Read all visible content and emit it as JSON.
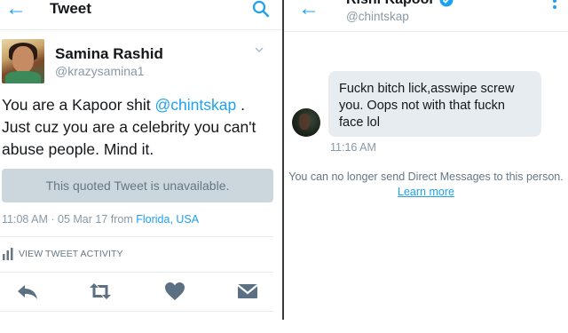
{
  "left": {
    "header": {
      "back_icon": "arrow-left-icon",
      "title": "Tweet",
      "search_icon": "search-icon"
    },
    "author": {
      "name": "Samina Rashid",
      "handle": "@krazysamina1"
    },
    "tweet": {
      "text_before": "You are a Kapoor shit ",
      "mention": "@chintskap",
      "text_after": " . Just cuz you are a celebrity you can't abuse people. Mind it."
    },
    "quoted": "This quoted Tweet is unavailable.",
    "meta": {
      "time_date": "11:08 AM · 05 Mar 17",
      "from": "from",
      "location": "Florida, USA"
    },
    "activity": "VIEW TWEET ACTIVITY",
    "actions": [
      "reply-icon",
      "retweet-icon",
      "like-icon",
      "dm-icon"
    ]
  },
  "right": {
    "header": {
      "back_icon": "arrow-left-icon",
      "name": "Rishi Kapoor",
      "handle": "@chintskap",
      "menu_icon": "more-vertical-icon"
    },
    "message": {
      "text": "Fuckn bitch lick,asswipe screw you. Oops not with that fuckn face lol",
      "time": "11:16 AM"
    },
    "notice": "You can no longer send Direct Messages to this person.",
    "learn_more": "Learn more"
  },
  "colors": {
    "accent": "#1da1f2",
    "text": "#14171a",
    "muted": "#8899a6",
    "quoted_bg": "#ccd6dd",
    "bubble_bg": "#e6ecf0"
  }
}
